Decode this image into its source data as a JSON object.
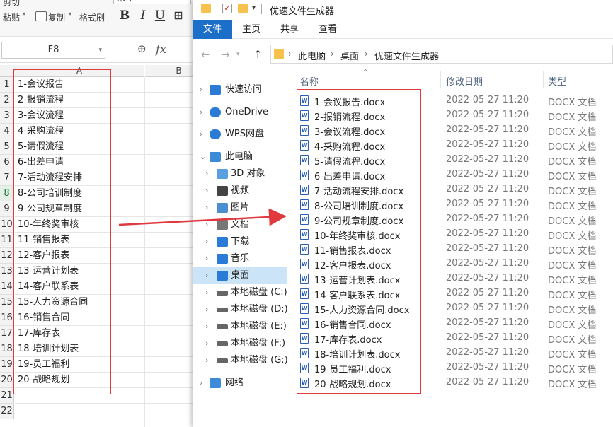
{
  "spreadsheet": {
    "ribbon": {
      "paste_label": "粘贴",
      "copy_label": "复制",
      "cut_label": "剪切",
      "format_painter_label": "格式刷",
      "bold": "B",
      "italic": "I",
      "underline": "U",
      "font_name": "宋体"
    },
    "name_box": "F8",
    "fx_label": "fx",
    "columns": [
      "A",
      "B"
    ],
    "selected_row": "8",
    "rows": [
      {
        "num": "1",
        "a": "1-会议报告"
      },
      {
        "num": "2",
        "a": "2-报销流程"
      },
      {
        "num": "3",
        "a": "3-会议流程"
      },
      {
        "num": "4",
        "a": "4-采购流程"
      },
      {
        "num": "5",
        "a": "5-请假流程"
      },
      {
        "num": "6",
        "a": "6-出差申请"
      },
      {
        "num": "7",
        "a": "7-活动流程安排"
      },
      {
        "num": "8",
        "a": "8-公司培训制度"
      },
      {
        "num": "9",
        "a": "9-公司规章制度"
      },
      {
        "num": "10",
        "a": "10-年终奖审核"
      },
      {
        "num": "11",
        "a": "11-销售报表"
      },
      {
        "num": "12",
        "a": "12-客户报表"
      },
      {
        "num": "13",
        "a": "13-运营计划表"
      },
      {
        "num": "14",
        "a": "14-客户联系表"
      },
      {
        "num": "15",
        "a": "15-人力资源合同"
      },
      {
        "num": "16",
        "a": "16-销售合同"
      },
      {
        "num": "17",
        "a": "17-库存表"
      },
      {
        "num": "18",
        "a": "18-培训计划表"
      },
      {
        "num": "19",
        "a": "19-员工福利"
      },
      {
        "num": "20",
        "a": "20-战略规划"
      },
      {
        "num": "21",
        "a": ""
      },
      {
        "num": "22",
        "a": ""
      }
    ]
  },
  "explorer": {
    "title": "优速文件生成器",
    "menu": [
      "文件",
      "主页",
      "共享",
      "查看"
    ],
    "breadcrumb": [
      "此电脑",
      "桌面",
      "优速文件生成器"
    ],
    "nav_items": [
      {
        "label": "快速访问",
        "icon": "star-icon"
      },
      {
        "label": "OneDrive",
        "icon": "cloud-icon"
      },
      {
        "label": "WPS网盘",
        "icon": "cloud-icon"
      },
      {
        "label": "此电脑",
        "icon": "computer-icon"
      },
      {
        "label": "3D 对象",
        "icon": "cube-icon"
      },
      {
        "label": "视频",
        "icon": "film-icon"
      },
      {
        "label": "图片",
        "icon": "picture-icon"
      },
      {
        "label": "文档",
        "icon": "document-icon"
      },
      {
        "label": "下载",
        "icon": "download-icon"
      },
      {
        "label": "音乐",
        "icon": "music-icon"
      },
      {
        "label": "桌面",
        "icon": "desktop-icon"
      },
      {
        "label": "本地磁盘 (C:)",
        "icon": "drive-icon"
      },
      {
        "label": "本地磁盘 (D:)",
        "icon": "drive-icon"
      },
      {
        "label": "本地磁盘 (E:)",
        "icon": "drive-icon"
      },
      {
        "label": "本地磁盘 (F:)",
        "icon": "drive-icon"
      },
      {
        "label": "本地磁盘 (G:)",
        "icon": "drive-icon"
      },
      {
        "label": "网络",
        "icon": "network-icon"
      }
    ],
    "columns": {
      "name": "名称",
      "date": "修改日期",
      "type": "类型"
    },
    "files": [
      {
        "name": "1-会议报告.docx",
        "date": "2022-05-27 11:20",
        "type": "DOCX 文档"
      },
      {
        "name": "2-报销流程.docx",
        "date": "2022-05-27 11:20",
        "type": "DOCX 文档"
      },
      {
        "name": "3-会议流程.docx",
        "date": "2022-05-27 11:20",
        "type": "DOCX 文档"
      },
      {
        "name": "4-采购流程.docx",
        "date": "2022-05-27 11:20",
        "type": "DOCX 文档"
      },
      {
        "name": "5-请假流程.docx",
        "date": "2022-05-27 11:20",
        "type": "DOCX 文档"
      },
      {
        "name": "6-出差申请.docx",
        "date": "2022-05-27 11:20",
        "type": "DOCX 文档"
      },
      {
        "name": "7-活动流程安排.docx",
        "date": "2022-05-27 11:20",
        "type": "DOCX 文档"
      },
      {
        "name": "8-公司培训制度.docx",
        "date": "2022-05-27 11:20",
        "type": "DOCX 文档"
      },
      {
        "name": "9-公司规章制度.docx",
        "date": "2022-05-27 11:20",
        "type": "DOCX 文档"
      },
      {
        "name": "10-年终奖审核.docx",
        "date": "2022-05-27 11:20",
        "type": "DOCX 文档"
      },
      {
        "name": "11-销售报表.docx",
        "date": "2022-05-27 11:20",
        "type": "DOCX 文档"
      },
      {
        "name": "12-客户报表.docx",
        "date": "2022-05-27 11:20",
        "type": "DOCX 文档"
      },
      {
        "name": "13-运营计划表.docx",
        "date": "2022-05-27 11:20",
        "type": "DOCX 文档"
      },
      {
        "name": "14-客户联系表.docx",
        "date": "2022-05-27 11:20",
        "type": "DOCX 文档"
      },
      {
        "name": "15-人力资源合同.docx",
        "date": "2022-05-27 11:20",
        "type": "DOCX 文档"
      },
      {
        "name": "16-销售合同.docx",
        "date": "2022-05-27 11:20",
        "type": "DOCX 文档"
      },
      {
        "name": "17-库存表.docx",
        "date": "2022-05-27 11:20",
        "type": "DOCX 文档"
      },
      {
        "name": "18-培训计划表.docx",
        "date": "2022-05-27 11:20",
        "type": "DOCX 文档"
      },
      {
        "name": "19-员工福利.docx",
        "date": "2022-05-27 11:20",
        "type": "DOCX 文档"
      },
      {
        "name": "20-战略规划.docx",
        "date": "2022-05-27 11:20",
        "type": "DOCX 文档"
      }
    ]
  },
  "colors": {
    "accent": "#1b6fc8",
    "highlight_box": "#e0393e",
    "nav_selected": "#cce4f7",
    "folder": "#f6c24b"
  }
}
